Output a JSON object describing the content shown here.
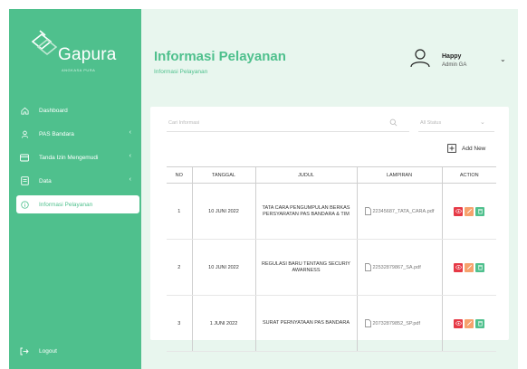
{
  "app": {
    "logo_text": "Gapura",
    "logo_sub": "ANGKASA PURA"
  },
  "sidebar": {
    "items": [
      {
        "label": "Dashboard",
        "icon": "home-icon",
        "has_chevron": false,
        "active": false
      },
      {
        "label": "PAS Bandara",
        "icon": "user-icon",
        "has_chevron": true,
        "active": false
      },
      {
        "label": "Tanda Izin Mengemudi",
        "icon": "card-icon",
        "has_chevron": true,
        "active": false
      },
      {
        "label": "Data",
        "icon": "document-icon",
        "has_chevron": true,
        "active": false
      },
      {
        "label": "Informasi Pelayanan",
        "icon": "info-icon",
        "has_chevron": false,
        "active": true
      }
    ],
    "logout_label": "Logout"
  },
  "header": {
    "title": "Informasi Pelayanan",
    "breadcrumb": "Informasi Pelayanan",
    "user": {
      "name": "Happy",
      "role": "Admin GA"
    }
  },
  "toolbar": {
    "search_placeholder": "Cari Informasi",
    "filter_value": "All Status",
    "add_label": "Add New"
  },
  "table": {
    "columns": [
      "NO",
      "TANGGAL",
      "JUDUL",
      "LAMPIRAN",
      "ACTION"
    ],
    "rows": [
      {
        "no": "1",
        "tanggal": "10 JUNI 2022",
        "judul": "TATA CARA PENGUMPULAN BERKAS PERSYARATAN PAS BANDARA & TIM",
        "lampiran": "22345687_TATA_CARA.pdf"
      },
      {
        "no": "2",
        "tanggal": "10 JUNI 2022",
        "judul": "REGULASI BARU TENTANG SECURIY AWARNESS",
        "lampiran": "22532879867_SA.pdf"
      },
      {
        "no": "3",
        "tanggal": "1 JUNI 2022",
        "judul": "SURAT PERNYATAAN PAS BANDARA",
        "lampiran": "20732879852_SP.pdf"
      }
    ]
  },
  "colors": {
    "brand": "#4fc08d",
    "view": "#e63946",
    "edit": "#f6a26d",
    "delete": "#4fc08d"
  }
}
